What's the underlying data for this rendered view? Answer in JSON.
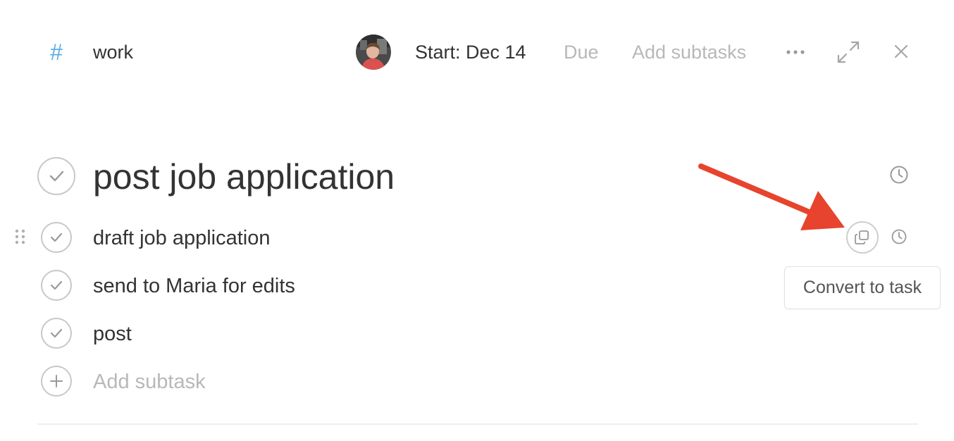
{
  "header": {
    "project_icon": "hash-icon",
    "project_name": "work",
    "assignee_avatar": "user-avatar",
    "start_label": "Start: Dec 14",
    "due_label": "Due",
    "add_subtasks_label": "Add subtasks",
    "more_icon": "more-horizontal-icon",
    "expand_icon": "expand-icon",
    "close_icon": "close-icon"
  },
  "task": {
    "title": "post job application",
    "complete_icon": "checkmark-icon",
    "reminder_icon": "clock-icon"
  },
  "subtasks": [
    {
      "label": "draft job application"
    },
    {
      "label": "send to Maria for edits"
    },
    {
      "label": "post"
    }
  ],
  "add_subtask": {
    "placeholder": "Add subtask",
    "icon": "plus-icon"
  },
  "hover_actions": {
    "convert_icon": "copy-icon",
    "reminder_icon": "clock-icon",
    "tooltip": "Convert to task"
  },
  "colors": {
    "accent": "#5aaee8",
    "text": "#333333",
    "muted": "#b8b8b8",
    "annotation_arrow": "#e8432d"
  }
}
